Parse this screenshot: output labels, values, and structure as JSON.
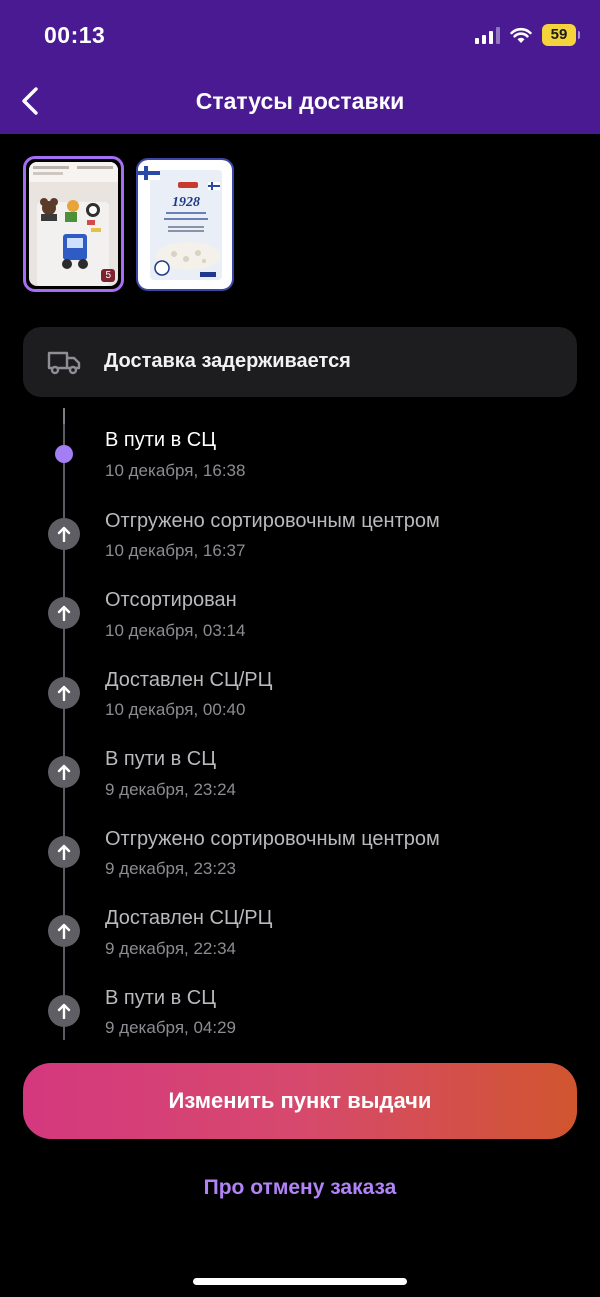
{
  "status_bar": {
    "time": "00:13",
    "battery": "59"
  },
  "header": {
    "title": "Статусы доставки"
  },
  "thumbnails": [
    {
      "badge": "5",
      "label": "cake-topper product"
    },
    {
      "brand": "1928",
      "label": "oat flakes product"
    }
  ],
  "delay_card": {
    "text": "Доставка задерживается"
  },
  "events": [
    {
      "title": "В пути в СЦ",
      "date": "10 декабря, 16:38",
      "active": true
    },
    {
      "title": "Отгружено сортировочным центром",
      "date": "10 декабря, 16:37"
    },
    {
      "title": "Отсортирован",
      "date": "10 декабря, 03:14"
    },
    {
      "title": "Доставлен СЦ/РЦ",
      "date": "10 декабря, 00:40"
    },
    {
      "title": "В пути в СЦ",
      "date": "9 декабря, 23:24"
    },
    {
      "title": "Отгружено сортировочным центром",
      "date": "9 декабря, 23:23"
    },
    {
      "title": "Доставлен СЦ/РЦ",
      "date": "9 декабря, 22:34"
    },
    {
      "title": "В пути в СЦ",
      "date": "9 декабря, 04:29"
    }
  ],
  "actions": {
    "change_pickup": "Изменить пункт выдачи",
    "cancel_info": "Про отмену заказа"
  },
  "colors": {
    "header_bg": "#4a1a93",
    "accent_purple": "#a47ef5",
    "link_purple": "#b283f7",
    "cta_gradient_start": "#d4387e",
    "cta_gradient_end": "#d1552f"
  }
}
